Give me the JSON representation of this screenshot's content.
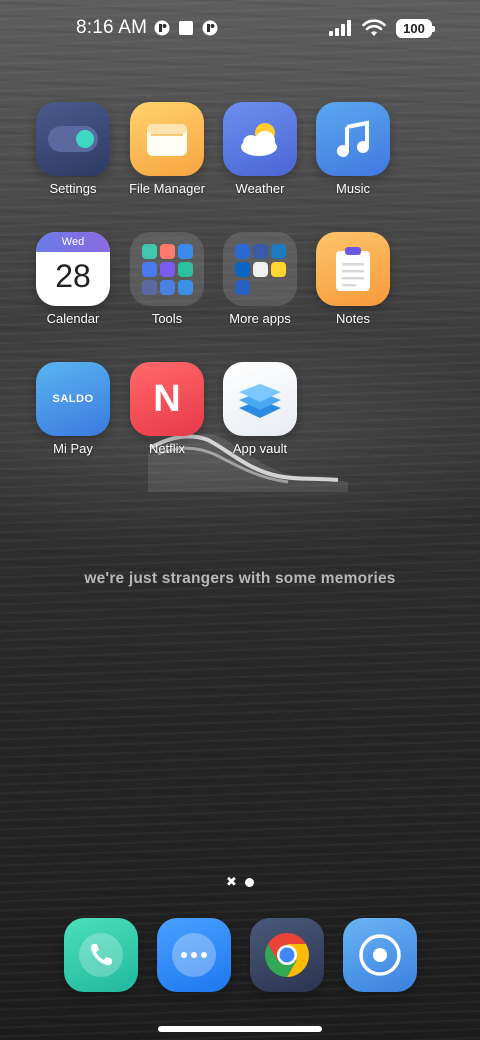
{
  "status_bar": {
    "time": "8:16 AM",
    "battery": "100",
    "left_icons": [
      "notification-icon",
      "square-icon",
      "notification-icon"
    ],
    "right_icons": [
      "signal-icon",
      "wifi-icon",
      "battery-icon"
    ]
  },
  "apps": [
    {
      "label": "Settings",
      "icon": "toggle-icon"
    },
    {
      "label": "File Manager",
      "icon": "folder-icon"
    },
    {
      "label": "Weather",
      "icon": "sun-cloud-icon"
    },
    {
      "label": "Music",
      "icon": "music-note-icon"
    },
    {
      "label": "Calendar",
      "icon": "calendar-icon",
      "day": "Wed",
      "date": "28"
    },
    {
      "label": "Tools",
      "icon": "folder-icon"
    },
    {
      "label": "More apps",
      "icon": "folder-icon"
    },
    {
      "label": "Notes",
      "icon": "clipboard-icon"
    },
    {
      "label": "Mi Pay",
      "icon": "wallet-icon",
      "badge": "SALDO"
    },
    {
      "label": "Netflix",
      "icon": "netflix-icon",
      "glyph": "N"
    },
    {
      "label": "App vault",
      "icon": "stack-icon"
    }
  ],
  "quote": "we're just strangers with some memories",
  "pager": {
    "close_glyph": "✖",
    "pages": 1
  },
  "dock": [
    {
      "name": "phone",
      "icon": "phone-icon"
    },
    {
      "name": "messages",
      "icon": "chat-icon"
    },
    {
      "name": "chrome",
      "icon": "chrome-icon"
    },
    {
      "name": "camera",
      "icon": "camera-icon"
    }
  ],
  "colors": {
    "settings": "#3b4a76",
    "file_manager": "#f7b74f",
    "weather": "#5a7de0",
    "music": "#4b8fe6",
    "calendar_header": "#7a6ee0",
    "notes": "#f7a94d",
    "mi_pay": "#4a9fe6",
    "netflix": "#f04a5a",
    "phone": "#33c9a8",
    "messages": "#2f8fff",
    "camera": "#4a90e2"
  }
}
